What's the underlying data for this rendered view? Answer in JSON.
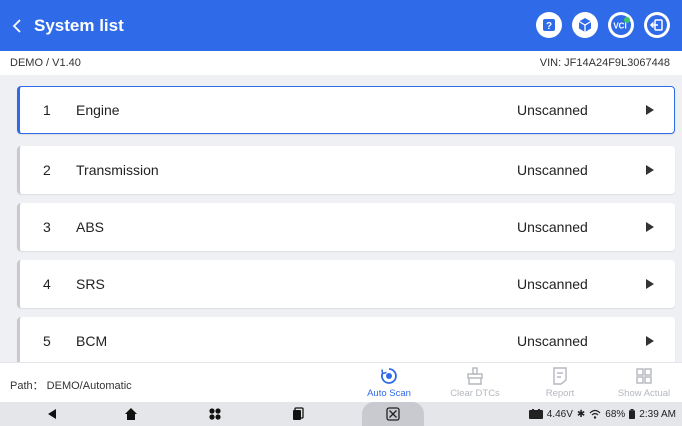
{
  "header": {
    "title": "System list",
    "icons": [
      "help-icon",
      "vehicle-info-icon",
      "vci-icon",
      "exit-icon"
    ],
    "vci_label": "VCI"
  },
  "info": {
    "version": "DEMO / V1.40",
    "vin": "VIN: JF14A24F9L3067448"
  },
  "systems": [
    {
      "num": "1",
      "name": "Engine",
      "status": "Unscanned",
      "active": true
    },
    {
      "num": "2",
      "name": "Transmission",
      "status": "Unscanned",
      "active": false
    },
    {
      "num": "3",
      "name": "ABS",
      "status": "Unscanned",
      "active": false
    },
    {
      "num": "4",
      "name": "SRS",
      "status": "Unscanned",
      "active": false
    },
    {
      "num": "5",
      "name": "BCM",
      "status": "Unscanned",
      "active": false
    }
  ],
  "footer": {
    "path": "Path： DEMO/Automatic",
    "auto_scan": "Auto Scan",
    "clear_dtcs": "Clear DTCs",
    "report": "Report",
    "show_actual": "Show Actual"
  },
  "statusbar": {
    "voltage": "4.46V",
    "battery": "68%",
    "time": "2:39 AM"
  },
  "colors": {
    "accent": "#2f6ae8",
    "disabled": "#b3b7bd"
  }
}
